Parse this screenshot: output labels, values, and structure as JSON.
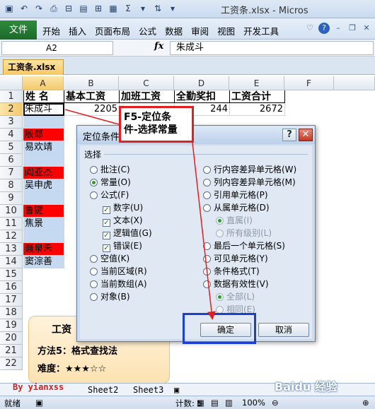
{
  "app": {
    "title": "工资条.xlsx - Micros"
  },
  "qat": {
    "icons": [
      "save-icon",
      "undo-icon",
      "redo-icon",
      "print-preview-icon"
    ]
  },
  "ribbon": {
    "file_tab": "文件",
    "tabs": [
      "开始",
      "插入",
      "页面布局",
      "公式",
      "数据",
      "审阅",
      "视图",
      "开发工具"
    ]
  },
  "formula_bar": {
    "name_box": "A2",
    "fx_label": "fx",
    "content": "朱成斗"
  },
  "doc_tab": {
    "label": "工资条.xlsx"
  },
  "grid": {
    "columns": [
      "A",
      "B",
      "C",
      "D",
      "E",
      "F"
    ],
    "rows": [
      "1",
      "2",
      "3",
      "4",
      "5",
      "6",
      "7",
      "8",
      "9",
      "10",
      "11",
      "12",
      "13",
      "14",
      "15",
      "16",
      "17",
      "18",
      "19",
      "20",
      "21",
      "22"
    ],
    "header_cells": [
      "姓  名",
      "基本工资",
      "加班工资",
      "全勤奖扣",
      "工资合计"
    ],
    "row2": {
      "name": "朱成斗",
      "base": "2205",
      "overtime": "",
      "attendance": "244",
      "total": "2672"
    },
    "names": {
      "r4": "殷郎",
      "r5": "易欢靖",
      "r6": "",
      "r7": "阎亚杰",
      "r8": "吴申虎",
      "r10": "鲁键",
      "r11": "焦景",
      "r13": "聂泉禾",
      "r14": "窦淙善"
    }
  },
  "callout": {
    "line1": "F5-定位条",
    "line2": "件-选择常量"
  },
  "tip": {
    "title": "工资",
    "line1": "方法5：格式查找法",
    "line2": "难度：★★★☆☆"
  },
  "dialog": {
    "title": "定位条件",
    "help": "?",
    "close": "✕",
    "group": "选择",
    "left_options": {
      "annotation": "批注(C)",
      "constants": "常量(O)",
      "formulas": "公式(F)",
      "numbers": "数字(U)",
      "text": "文本(X)",
      "logicals": "逻辑值(G)",
      "errors": "错误(E)",
      "blanks": "空值(K)",
      "current_region": "当前区域(R)",
      "current_array": "当前数组(A)",
      "objects": "对象(B)"
    },
    "right_options": {
      "row_diff": "行内容差异单元格(W)",
      "col_diff": "列内容差异单元格(M)",
      "precedents": "引用单元格(P)",
      "dependents": "从属单元格(D)",
      "direct_only": "直属(I)",
      "all_levels": "所有级别(L)",
      "last_cell": "最后一个单元格(S)",
      "visible_cells": "可见单元格(Y)",
      "cond_formats": "条件格式(T)",
      "data_validation": "数据有效性(V)",
      "all": "全部(L)",
      "same": "相同(E)"
    },
    "ok": "确定",
    "cancel": "取消"
  },
  "sheets": {
    "tab2": "Sheet2",
    "tab3": "Sheet3",
    "author": "By yianxss"
  },
  "status": {
    "ready": "就绪",
    "count": "计数: 5",
    "zoom": "100%"
  },
  "watermark": "Baidu 经验"
}
